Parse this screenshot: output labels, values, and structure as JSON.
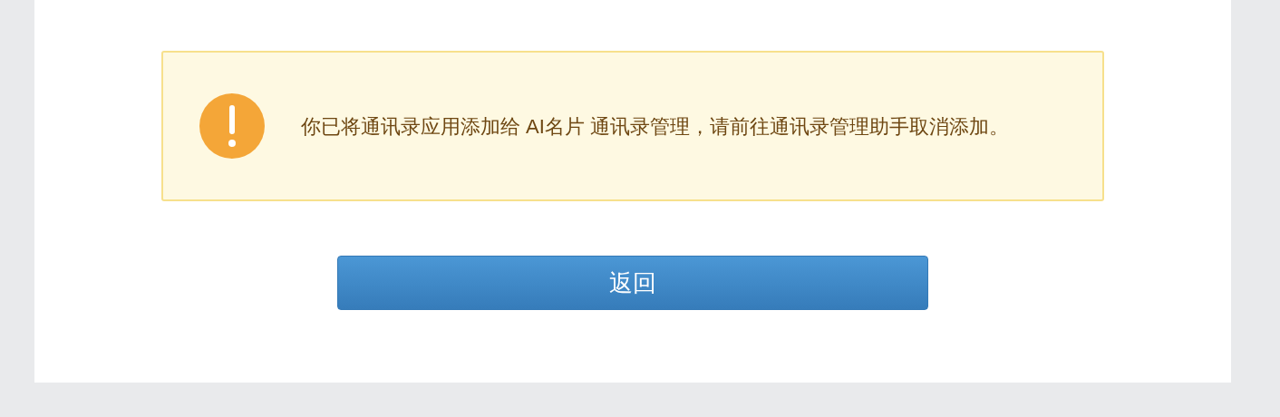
{
  "notice": {
    "message": "你已将通讯录应用添加给 AI名片 通讯录管理，请前往通讯录管理助手取消添加。"
  },
  "buttons": [
    {
      "label": "返回"
    }
  ]
}
